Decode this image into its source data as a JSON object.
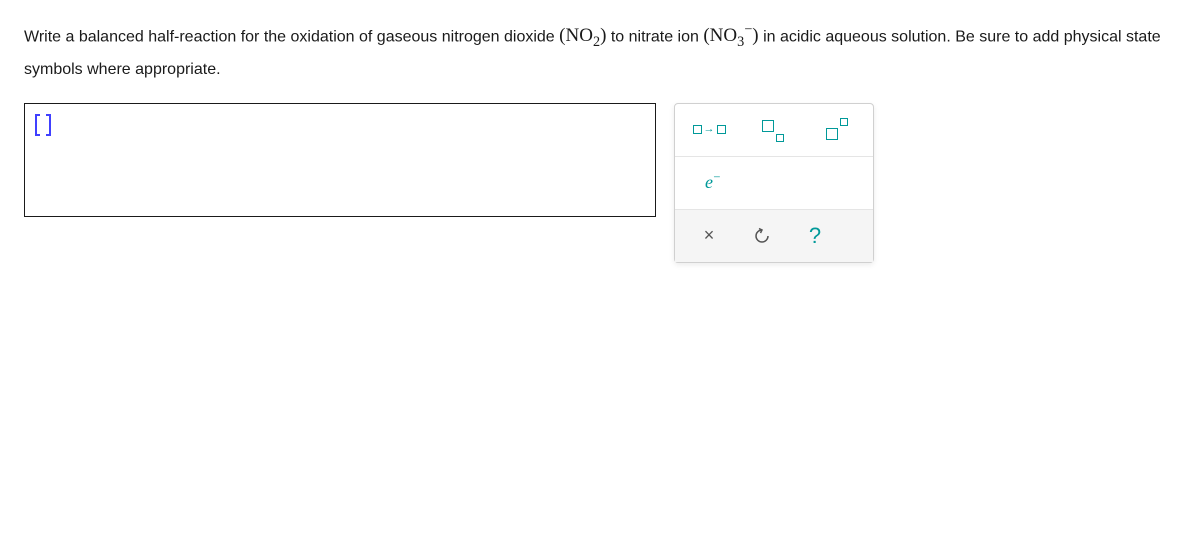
{
  "question": {
    "part1": "Write a balanced half-reaction for the oxidation of gaseous nitrogen dioxide ",
    "formula1_base": "NO",
    "formula1_sub": "2",
    "part2": " to nitrate ion ",
    "formula2_base": "NO",
    "formula2_sub": "3",
    "formula2_sup": "−",
    "part3": " in acidic aqueous solution. Be sure to add physical state symbols where appropriate."
  },
  "answer": {
    "value": ""
  },
  "toolbox": {
    "reaction_label": "reaction-arrow",
    "subscript_label": "subscript",
    "superscript_label": "superscript",
    "electron_label": "e",
    "electron_sup": "−",
    "clear_label": "×",
    "reset_label": "reset",
    "help_label": "?"
  }
}
